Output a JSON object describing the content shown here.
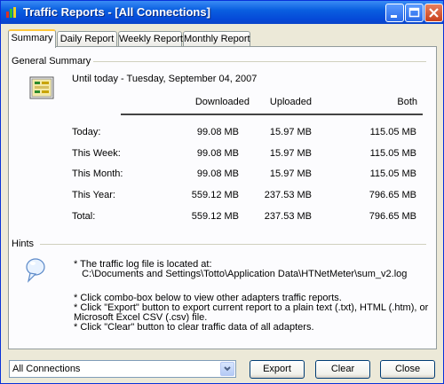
{
  "window": {
    "title": "Traffic Reports - [All Connections]",
    "controls": {
      "minimize": "minimize",
      "maximize": "maximize",
      "close": "close"
    }
  },
  "tabs": [
    {
      "label": "Summary",
      "active": true
    },
    {
      "label": "Daily Report",
      "active": false
    },
    {
      "label": "Weekly Report",
      "active": false
    },
    {
      "label": "Monthly Report",
      "active": false
    }
  ],
  "summary": {
    "group_title": "General Summary",
    "date_text": "Until today - Tuesday, September 04, 2007",
    "columns": [
      "Downloaded",
      "Uploaded",
      "Both"
    ],
    "rows": [
      {
        "label": "Today:",
        "downloaded": "99.08 MB",
        "uploaded": "15.97 MB",
        "both": "115.05 MB"
      },
      {
        "label": "This Week:",
        "downloaded": "99.08 MB",
        "uploaded": "15.97 MB",
        "both": "115.05 MB"
      },
      {
        "label": "This Month:",
        "downloaded": "99.08 MB",
        "uploaded": "15.97 MB",
        "both": "115.05 MB"
      },
      {
        "label": "This Year:",
        "downloaded": "559.12 MB",
        "uploaded": "237.53 MB",
        "both": "796.65 MB"
      },
      {
        "label": "Total:",
        "downloaded": "559.12 MB",
        "uploaded": "237.53 MB",
        "both": "796.65 MB"
      }
    ]
  },
  "hints": {
    "group_title": "Hints",
    "lines": [
      "* The traffic log file is located at:",
      "   C:\\Documents and Settings\\Totto\\Application Data\\HTNetMeter\\sum_v2.log",
      "* Click combo-box below to view other adapters traffic reports.",
      "* Click \"Export\" button to export current report to a plain text (.txt), HTML (.htm), or",
      "Microsoft Excel CSV (.csv) file.",
      "* Click \"Clear\" button to clear traffic data of all adapters."
    ]
  },
  "footer": {
    "adapter_select": "All Connections",
    "export_label": "Export",
    "clear_label": "Clear",
    "close_label": "Close"
  },
  "colors": {
    "titlebar": "#0a5fe0",
    "dialog_bg": "#ece9d8",
    "panel_bg": "#fcfcfe",
    "active_tab_accent": "#ffc73c"
  }
}
